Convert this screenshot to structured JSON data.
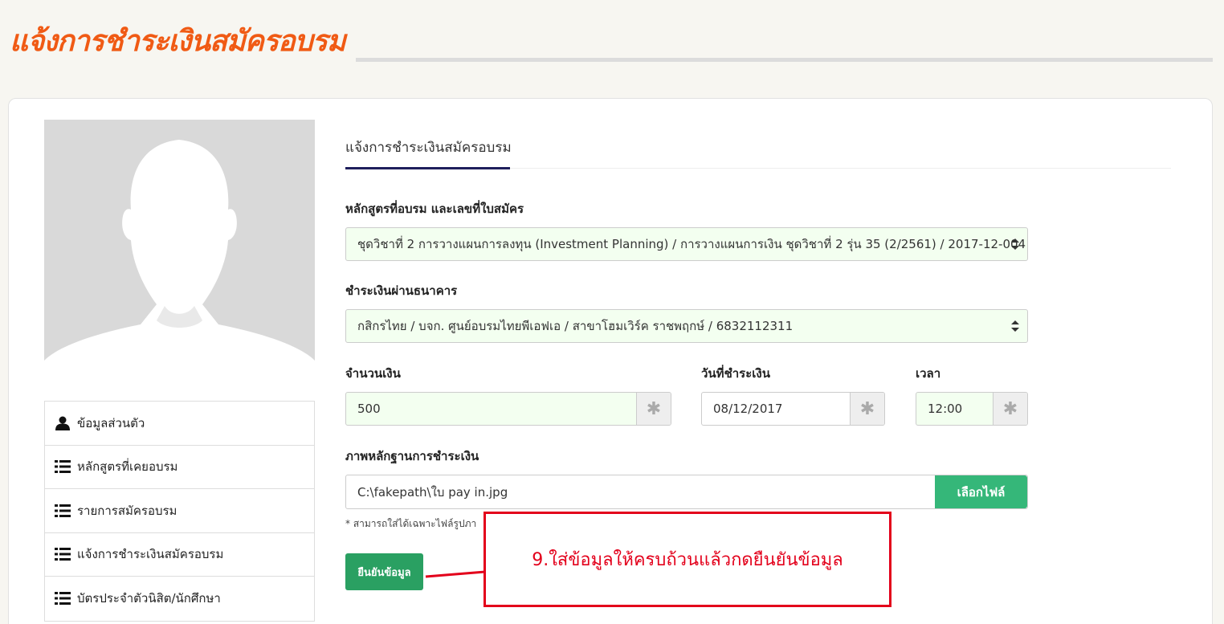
{
  "page": {
    "title": "แจ้งการชำระเงินสมัครอบรม"
  },
  "sidebar": {
    "items": [
      {
        "label": "ข้อมูลส่วนตัว",
        "icon": "user-icon"
      },
      {
        "label": "หลักสูตรที่เคยอบรม",
        "icon": "list-icon"
      },
      {
        "label": "รายการสมัครอบรม",
        "icon": "list-icon"
      },
      {
        "label": "แจ้งการชำระเงินสมัครอบรม",
        "icon": "list-icon"
      },
      {
        "label": "บัตรประจำตัวนิสิต/นักศึกษา",
        "icon": "list-icon"
      }
    ]
  },
  "form": {
    "tab_label": "แจ้งการชำระเงินสมัครอบรม",
    "course_label": "หลักสูตรที่อบรม และเลขที่ใบสมัคร",
    "course_value": "ชุดวิชาที่ 2 การวางแผนการลงทุน (Investment Planning) / การวางแผนการเงิน ชุดวิชาที่ 2 รุ่น 35 (2/2561) / 2017-12-004",
    "bank_label": "ชำระเงินผ่านธนาคาร",
    "bank_value": "กสิกรไทย / บจก. ศูนย์อบรมไทยพีเอฟเอ / สาขาโฮมเวิร์ค ราชพฤกษ์ / 6832112311",
    "amount_label": "จำนวนเงิน",
    "amount_value": "500",
    "date_label": "วันที่ชำระเงิน",
    "date_value": "08/12/2017",
    "time_label": "เวลา",
    "time_value": "12:00",
    "required_mark": "✱",
    "evidence_label": "ภาพหลักฐานการชำระเงิน",
    "file_value": "C:\\fakepath\\ใบ pay in.jpg",
    "file_button": "เลือกไฟล์",
    "hint": "* สามารถใส่ได้เฉพาะไฟล์รูปภา",
    "submit_button": "ยืนยันข้อมูล"
  },
  "callout": {
    "text": "9.ใส่ข้อมูลให้ครบถ้วนแล้วกดยืนยันข้อมูล",
    "color": "#e3001b"
  },
  "colors": {
    "title": "#f05a14",
    "accent_green": "#35b779",
    "submit_green": "#2aa062",
    "tab_underline": "#1f1f5c"
  }
}
